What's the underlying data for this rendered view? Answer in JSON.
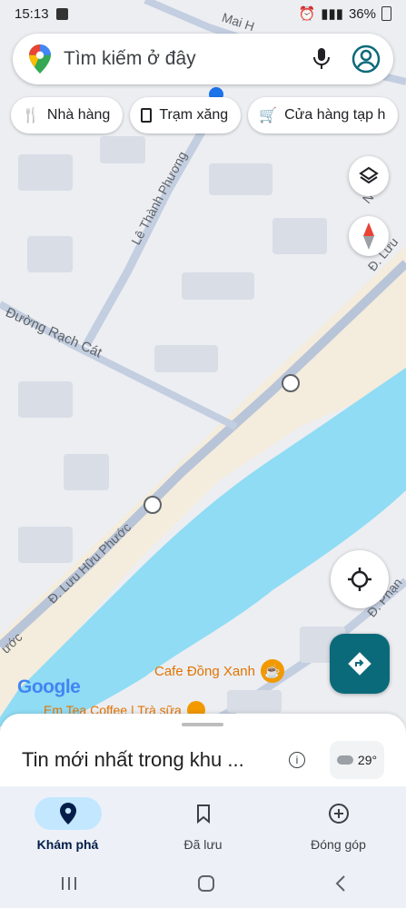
{
  "status_bar": {
    "time": "15:13",
    "battery": "36%"
  },
  "search": {
    "placeholder": "Tìm kiếm ở đây"
  },
  "chips": [
    {
      "label": "Nhà hàng",
      "icon": "restaurant-icon"
    },
    {
      "label": "Trạm xăng",
      "icon": "gas-station-icon"
    },
    {
      "label": "Cửa hàng tạp h",
      "icon": "grocery-cart-icon"
    }
  ],
  "map_labels": {
    "street_top": "Mai H",
    "street_le_thanh_phuong": "Lê Thành Phương",
    "street_rach_cat": "Đường Rạch Cát",
    "street_luu_huu_phuoc": "Đ. Lưu Hữu Phước",
    "street_luu_right": "Đ. Lưu",
    "street_phan": "Đ. Phạn",
    "street_phuoc_left": "ước",
    "street_n": "N",
    "cafe_dong_xanh": "Cafe Đồng Xanh",
    "em_tea": "Em Tea Coffee | Trà sữa",
    "google_logo": "Google"
  },
  "sheet": {
    "title": "Tin mới nhất trong khu ...",
    "temperature": "29°"
  },
  "bottom_nav": [
    {
      "label": "Khám phá",
      "icon": "explore-pin-icon",
      "active": true
    },
    {
      "label": "Đã lưu",
      "icon": "bookmark-icon",
      "active": false
    },
    {
      "label": "Đóng góp",
      "icon": "add-circle-icon",
      "active": false
    }
  ],
  "colors": {
    "water": "#8fdcf4",
    "beach": "#f4ecdc",
    "map_bg": "#eceef2",
    "road": "#b8c4d8",
    "nav_active": "#c2e7ff",
    "directions_button": "#0b6a7a"
  }
}
